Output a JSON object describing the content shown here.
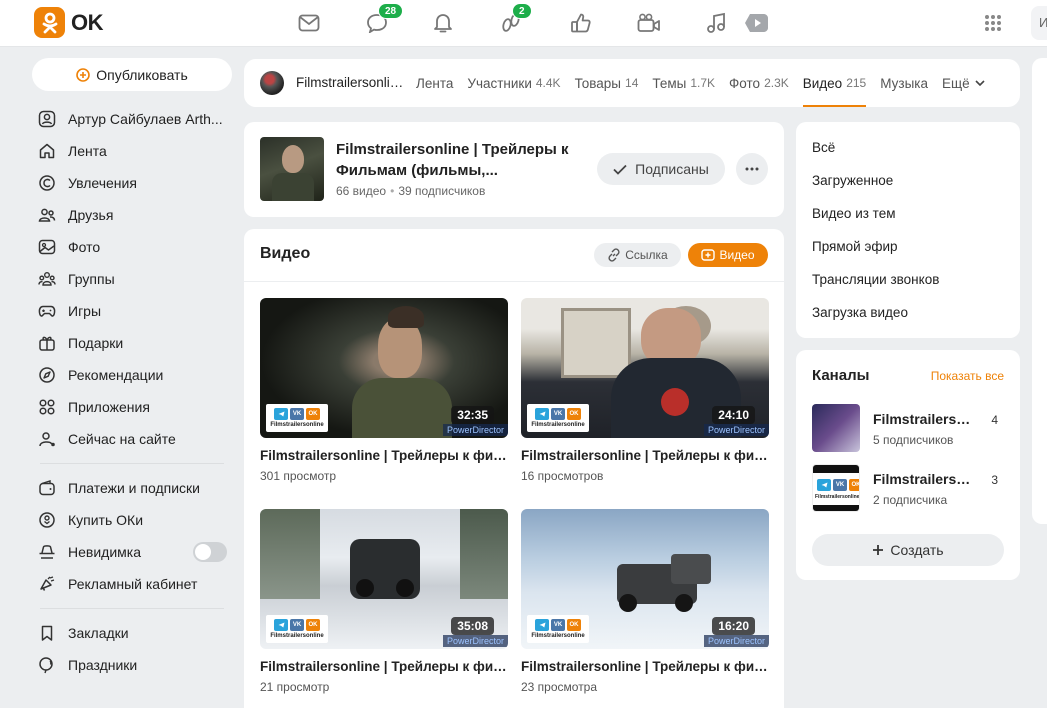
{
  "header": {
    "logo_text": "OK",
    "notifications": {
      "messages_badge": "28",
      "guests_badge": "2"
    },
    "search_stub": "И"
  },
  "sidebar": {
    "publish_label": "Опубликовать",
    "items": [
      {
        "label": "Артур Сайбулаев Arth...",
        "icon": "user-icon"
      },
      {
        "label": "Лента",
        "icon": "home-icon"
      },
      {
        "label": "Увлечения",
        "icon": "hobby-icon"
      },
      {
        "label": "Друзья",
        "icon": "friends-icon"
      },
      {
        "label": "Фото",
        "icon": "photo-icon"
      },
      {
        "label": "Группы",
        "icon": "groups-icon"
      },
      {
        "label": "Игры",
        "icon": "gamepad-icon"
      },
      {
        "label": "Подарки",
        "icon": "gift-icon"
      },
      {
        "label": "Рекомендации",
        "icon": "compass-icon"
      },
      {
        "label": "Приложения",
        "icon": "apps-icon"
      },
      {
        "label": "Сейчас на сайте",
        "icon": "online-icon"
      }
    ],
    "items2": [
      {
        "label": "Платежи и подписки",
        "icon": "wallet-icon"
      },
      {
        "label": "Купить ОКи",
        "icon": "coin-icon"
      },
      {
        "label": "Невидимка",
        "icon": "incognito-icon",
        "toggle": false
      },
      {
        "label": "Рекламный кабинет",
        "icon": "megaphone-icon"
      }
    ],
    "items3": [
      {
        "label": "Закладки",
        "icon": "bookmark-icon"
      },
      {
        "label": "Праздники",
        "icon": "balloon-icon"
      }
    ]
  },
  "tabs": {
    "group_name": "Filmstrailersonline | Трейлеры к Фильмам",
    "items": [
      {
        "label": "Лента",
        "count": ""
      },
      {
        "label": "Участники",
        "count": "4.4K"
      },
      {
        "label": "Товары",
        "count": "14"
      },
      {
        "label": "Темы",
        "count": "1.7K"
      },
      {
        "label": "Фото",
        "count": "2.3K"
      },
      {
        "label": "Видео",
        "count": "215",
        "active": true
      },
      {
        "label": "Музыка",
        "count": ""
      }
    ],
    "more_label": "Ещё"
  },
  "channel": {
    "title": "Filmstrailersonline | Трейлеры к Фильмам (фильмы,...",
    "videos": "66 видео",
    "subscribers": "39 подписчиков",
    "subscribed_label": "Подписаны"
  },
  "videos": {
    "title": "Видео",
    "link_label": "Ссылка",
    "upload_label": "Видео",
    "watermark_text": "Filmstrailersonline",
    "watermark_icons": [
      "VK",
      "OK"
    ],
    "powerdirector": "PowerDirector",
    "items": [
      {
        "title": "Filmstrailersonline | Трейлеры к фильмам",
        "views": "301 просмотр",
        "duration": "32:35"
      },
      {
        "title": "Filmstrailersonline | Трейлеры к фильмам",
        "views": "16 просмотров",
        "duration": "24:10"
      },
      {
        "title": "Filmstrailersonline | Трейлеры к фильмам",
        "views": "21 просмотр",
        "duration": "35:08"
      },
      {
        "title": "Filmstrailersonline | Трейлеры к фильмам",
        "views": "23 просмотра",
        "duration": "16:20"
      }
    ]
  },
  "filter": {
    "items": [
      "Всё",
      "Загруженное",
      "Видео из тем",
      "Прямой эфир",
      "Трансляции звонков",
      "Загрузка видео"
    ]
  },
  "channels": {
    "title": "Каналы",
    "show_all": "Показать все",
    "items": [
      {
        "name": "Filmstrailersonline",
        "subs": "5 подписчиков",
        "count": "4"
      },
      {
        "name": "Filmstrailersonline",
        "subs": "2 подписчика",
        "count": "3"
      }
    ],
    "create_label": "Создать"
  },
  "colors": {
    "accent": "#ee8208",
    "badge": "#1dae4a",
    "bg": "#eceef0"
  }
}
